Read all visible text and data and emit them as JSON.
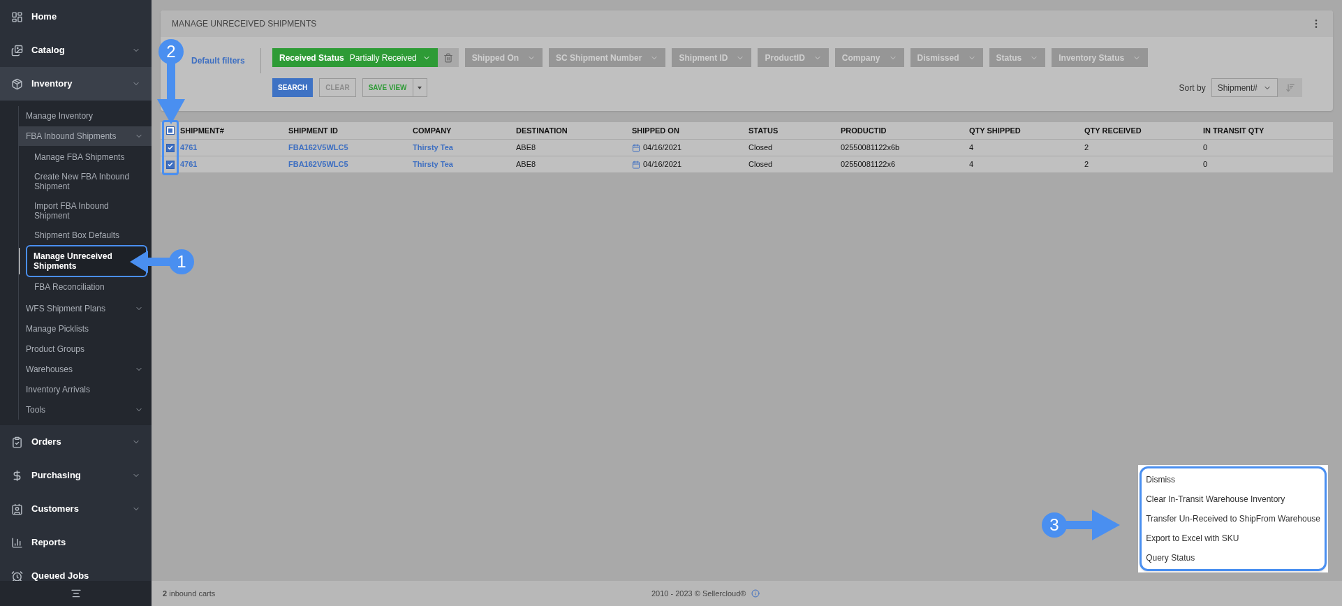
{
  "sidebar": {
    "items": [
      {
        "label": "Home",
        "selected": false
      },
      {
        "label": "Catalog",
        "selected": false,
        "expanded": false
      },
      {
        "label": "Inventory",
        "selected": false,
        "expanded": true,
        "children": [
          {
            "label": "Manage Inventory",
            "selected": false
          },
          {
            "label": "FBA Inbound Shipments",
            "selected": false,
            "expanded": true,
            "children": [
              {
                "label": "Manage FBA Shipments",
                "selected": false
              },
              {
                "label": "Create New FBA Inbound Shipment",
                "selected": false
              },
              {
                "label": "Import FBA Inbound Shipment",
                "selected": false
              },
              {
                "label": "Shipment Box Defaults",
                "selected": false
              },
              {
                "label": "Manage Unreceived Shipments",
                "selected": true
              },
              {
                "label": "FBA Reconciliation",
                "selected": false
              }
            ]
          },
          {
            "label": "WFS Shipment Plans",
            "selected": false,
            "expanded": false
          },
          {
            "label": "Manage Picklists",
            "selected": false
          },
          {
            "label": "Product Groups",
            "selected": false
          },
          {
            "label": "Warehouses",
            "selected": false,
            "expanded": false
          },
          {
            "label": "Inventory Arrivals",
            "selected": false
          },
          {
            "label": "Tools",
            "selected": false,
            "expanded": false
          }
        ]
      },
      {
        "label": "Orders",
        "selected": false,
        "expanded": false
      },
      {
        "label": "Purchasing",
        "selected": false,
        "expanded": false
      },
      {
        "label": "Customers",
        "selected": false,
        "expanded": false
      },
      {
        "label": "Reports",
        "selected": false
      },
      {
        "label": "Queued Jobs",
        "selected": false
      }
    ]
  },
  "page": {
    "title": "MANAGE UNRECEIVED SHIPMENTS",
    "default_filters": "Default filters",
    "filters": [
      {
        "label": "Received Status",
        "value": "Partially Received",
        "active": true
      },
      {
        "label": "Shipped On",
        "active": false
      },
      {
        "label": "SC Shipment Number",
        "active": false
      },
      {
        "label": "Shipment ID",
        "active": false
      },
      {
        "label": "ProductID",
        "active": false
      },
      {
        "label": "Company",
        "active": false
      },
      {
        "label": "Dismissed",
        "active": false
      },
      {
        "label": "Status",
        "active": false
      },
      {
        "label": "Inventory Status",
        "active": false
      }
    ],
    "buttons": [
      {
        "label": "SEARCH",
        "kind": "primary"
      },
      {
        "label": "CLEAR",
        "kind": "outline"
      },
      {
        "label": "SAVE VIEW",
        "kind": "split"
      }
    ],
    "sort": {
      "label": "Sort by",
      "value": "Shipment#"
    }
  },
  "table": {
    "select_all": {
      "checked": true
    },
    "columns": [
      {
        "label": "SHIPMENT#",
        "kind": "link"
      },
      {
        "label": "SHIPMENT ID",
        "kind": "link"
      },
      {
        "label": "COMPANY",
        "kind": "link"
      },
      {
        "label": "DESTINATION",
        "kind": "text"
      },
      {
        "label": "SHIPPED ON",
        "kind": "date"
      },
      {
        "label": "STATUS",
        "kind": "text"
      },
      {
        "label": "PRODUCTID",
        "kind": "text"
      },
      {
        "label": "QTY SHIPPED",
        "kind": "text"
      },
      {
        "label": "QTY RECEIVED",
        "kind": "text"
      },
      {
        "label": "IN TRANSIT QTY",
        "kind": "text"
      }
    ],
    "rows": [
      {
        "checked": true,
        "cells": [
          "4761",
          "FBA162V5WLC5",
          "Thirsty Tea",
          "ABE8",
          "04/16/2021",
          "Closed",
          "02550081122x6b",
          "4",
          "2",
          "0"
        ]
      },
      {
        "checked": true,
        "cells": [
          "4761",
          "FBA162V5WLC5",
          "Thirsty Tea",
          "ABE8",
          "04/16/2021",
          "Closed",
          "02550081122x6",
          "4",
          "2",
          "0"
        ]
      }
    ]
  },
  "context_menu": {
    "items": [
      "Dismiss",
      "Clear In-Transit Warehouse Inventory",
      "Transfer Un-Received to ShipFrom Warehouse",
      "Export to Excel with SKU",
      "Query Status"
    ]
  },
  "footer": {
    "count": "**2** inbound carts",
    "copyright": "2010 - 2023 © Sellercloud®"
  },
  "callouts": [
    "1",
    "2",
    "3"
  ]
}
